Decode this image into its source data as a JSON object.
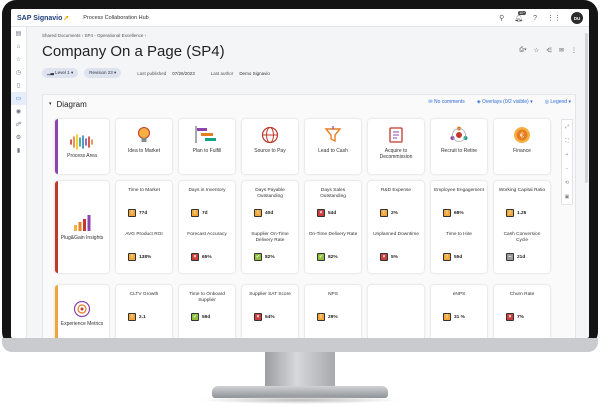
{
  "app": {
    "brand": "SAP Signavio",
    "hub_name": "Process Collaboration Hub",
    "notification_count": "10+",
    "avatar_initials": "DU"
  },
  "breadcrumb": {
    "items": [
      "Shared Documents",
      "SP4 - Operational Excellence"
    ]
  },
  "page": {
    "title": "Company On a Page (SP4)"
  },
  "meta": {
    "level": "Level 1",
    "revision": "Revision 23",
    "published_label": "Last published",
    "published_value": "07/26/2023",
    "author_label": "Last author",
    "author_value": "Demo Signavio"
  },
  "diagram": {
    "title": "Diagram",
    "no_comments": "No comments",
    "overlays": "Overlays (0/2 visible)",
    "legend": "Legend"
  },
  "rows": [
    {
      "lead": {
        "label": "Process Area",
        "bar_color": "#8e44ad"
      },
      "cards": [
        {
          "label": "Idea to Market"
        },
        {
          "label": "Plan to Fulfill"
        },
        {
          "label": "Source to Pay"
        },
        {
          "label": "Lead to Cash"
        },
        {
          "label": "Acquire to Decommission"
        },
        {
          "label": "Recruit to Retire"
        },
        {
          "label": "Finance"
        }
      ]
    },
    {
      "lead": {
        "label": "Plug&Gain Insights",
        "bar_color": "#c0392b"
      },
      "kpis": [
        {
          "t1": "Time to Market",
          "v1": "77d",
          "s1": "warn",
          "t2": "AVG Product ROI",
          "v2": "138%",
          "s2": "warn"
        },
        {
          "t1": "Days in Inventory",
          "v1": "7d",
          "s1": "warn",
          "t2": "Forecast Accuracy",
          "v2": "65%",
          "s2": "bad"
        },
        {
          "t1": "Days Payable Outstanding",
          "v1": "40d",
          "s1": "warn",
          "t2": "Supplier On-Time Delivery Rate",
          "v2": "82%",
          "s2": "good"
        },
        {
          "t1": "Days Sales Outstanding",
          "v1": "54d",
          "s1": "bad",
          "t2": "On-Time Delivery Rate",
          "v2": "82%",
          "s2": "good"
        },
        {
          "t1": "R&D Expense",
          "v1": "2%",
          "s1": "warn",
          "t2": "Unplanned Downtime",
          "v2": "5%",
          "s2": "bad"
        },
        {
          "t1": "Employee Engagement",
          "v1": "68%",
          "s1": "warn",
          "t2": "Time to Hire",
          "v2": "55d",
          "s2": "warn"
        },
        {
          "t1": "Working Capital Ratio",
          "v1": "1.25",
          "s1": "warn",
          "t2": "Cash Conversion Cycle",
          "v2": "21d",
          "s2": "neutral"
        }
      ]
    },
    {
      "lead": {
        "label": "Experience Metrics",
        "bar_color": "#f0a73a"
      },
      "kpis": [
        {
          "t1": "CLTV Growth",
          "v1": "2.1",
          "s1": "warn"
        },
        {
          "t1": "Time to Onboard Supplier",
          "v1": "59d",
          "s1": "good"
        },
        {
          "t1": "Supplier SAT Score",
          "v1": "54%",
          "s1": "bad"
        },
        {
          "t1": "NPS",
          "v1": "29%",
          "s1": "warn"
        },
        {
          "t1": "",
          "v1": "",
          "s1": ""
        },
        {
          "t1": "eNPS",
          "v1": "31 %",
          "s1": "warn"
        },
        {
          "t1": "Churn Rate",
          "v1": "7%",
          "s1": "bad"
        }
      ]
    }
  ]
}
